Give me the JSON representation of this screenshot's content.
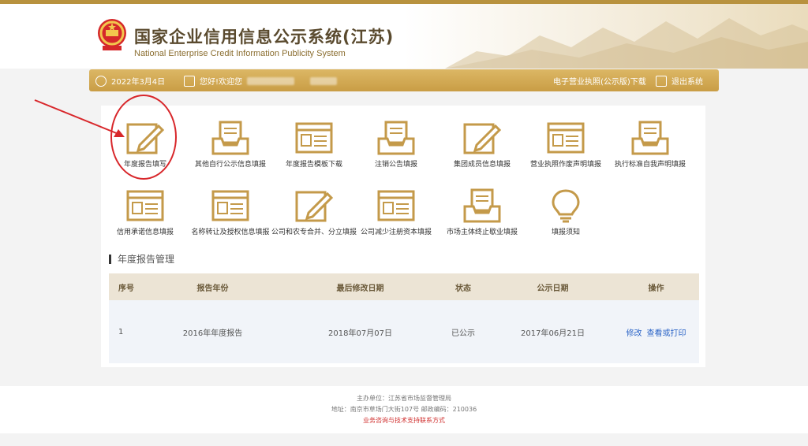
{
  "header": {
    "title": "国家企业信用信息公示系统(江苏)",
    "subtitle": "National Enterprise Credit Information Publicity System"
  },
  "info_bar": {
    "date": "2022年3月4日",
    "greeting": "您好!欢迎您",
    "download_link": "电子营业执照(公示版)下载",
    "logout": "退出系统"
  },
  "tiles": [
    {
      "label": "年度报告填写",
      "icon": "pencil-icon"
    },
    {
      "label": "其他自行公示信息填报",
      "icon": "tray-document-icon"
    },
    {
      "label": "年度报告模板下载",
      "icon": "window-list-icon"
    },
    {
      "label": "注销公告填报",
      "icon": "tray-document-icon"
    },
    {
      "label": "集团成员信息填报",
      "icon": "pencil-icon"
    },
    {
      "label": "营业执照作废声明填报",
      "icon": "window-list-icon"
    },
    {
      "label": "执行标准自我声明填报",
      "icon": "tray-document-icon"
    },
    {
      "label": "信用承诺信息填报",
      "icon": "window-list-icon"
    },
    {
      "label": "名称转让及授权信息填报",
      "icon": "window-list-icon"
    },
    {
      "label": "公司和农专合并、分立填报",
      "icon": "pencil-icon"
    },
    {
      "label": "公司减少注册资本填报",
      "icon": "window-list-icon"
    },
    {
      "label": "市场主体终止歇业填报",
      "icon": "tray-document-icon"
    },
    {
      "label": "填报须知",
      "icon": "lightbulb-icon"
    }
  ],
  "section_title": "年度报告管理",
  "table": {
    "headers": [
      "序号",
      "报告年份",
      "最后修改日期",
      "状态",
      "公示日期",
      "操作"
    ],
    "rows": [
      {
        "index": "1",
        "year": "2016年年度报告",
        "modified": "2018年07月07日",
        "status": "已公示",
        "publish_date": "2017年06月21日",
        "action_edit": "修改",
        "action_view": "查看或打印"
      }
    ]
  },
  "footer": {
    "sponsor": "主办单位：江苏省市场监督管理局",
    "address": "地址：南京市草场门大街107号    邮政编码：210036",
    "support_link": "业务咨询与技术支持联系方式"
  },
  "colors": {
    "gold": "#c99d45",
    "annotation_red": "#d8272b",
    "link_blue": "#2b64c7"
  }
}
